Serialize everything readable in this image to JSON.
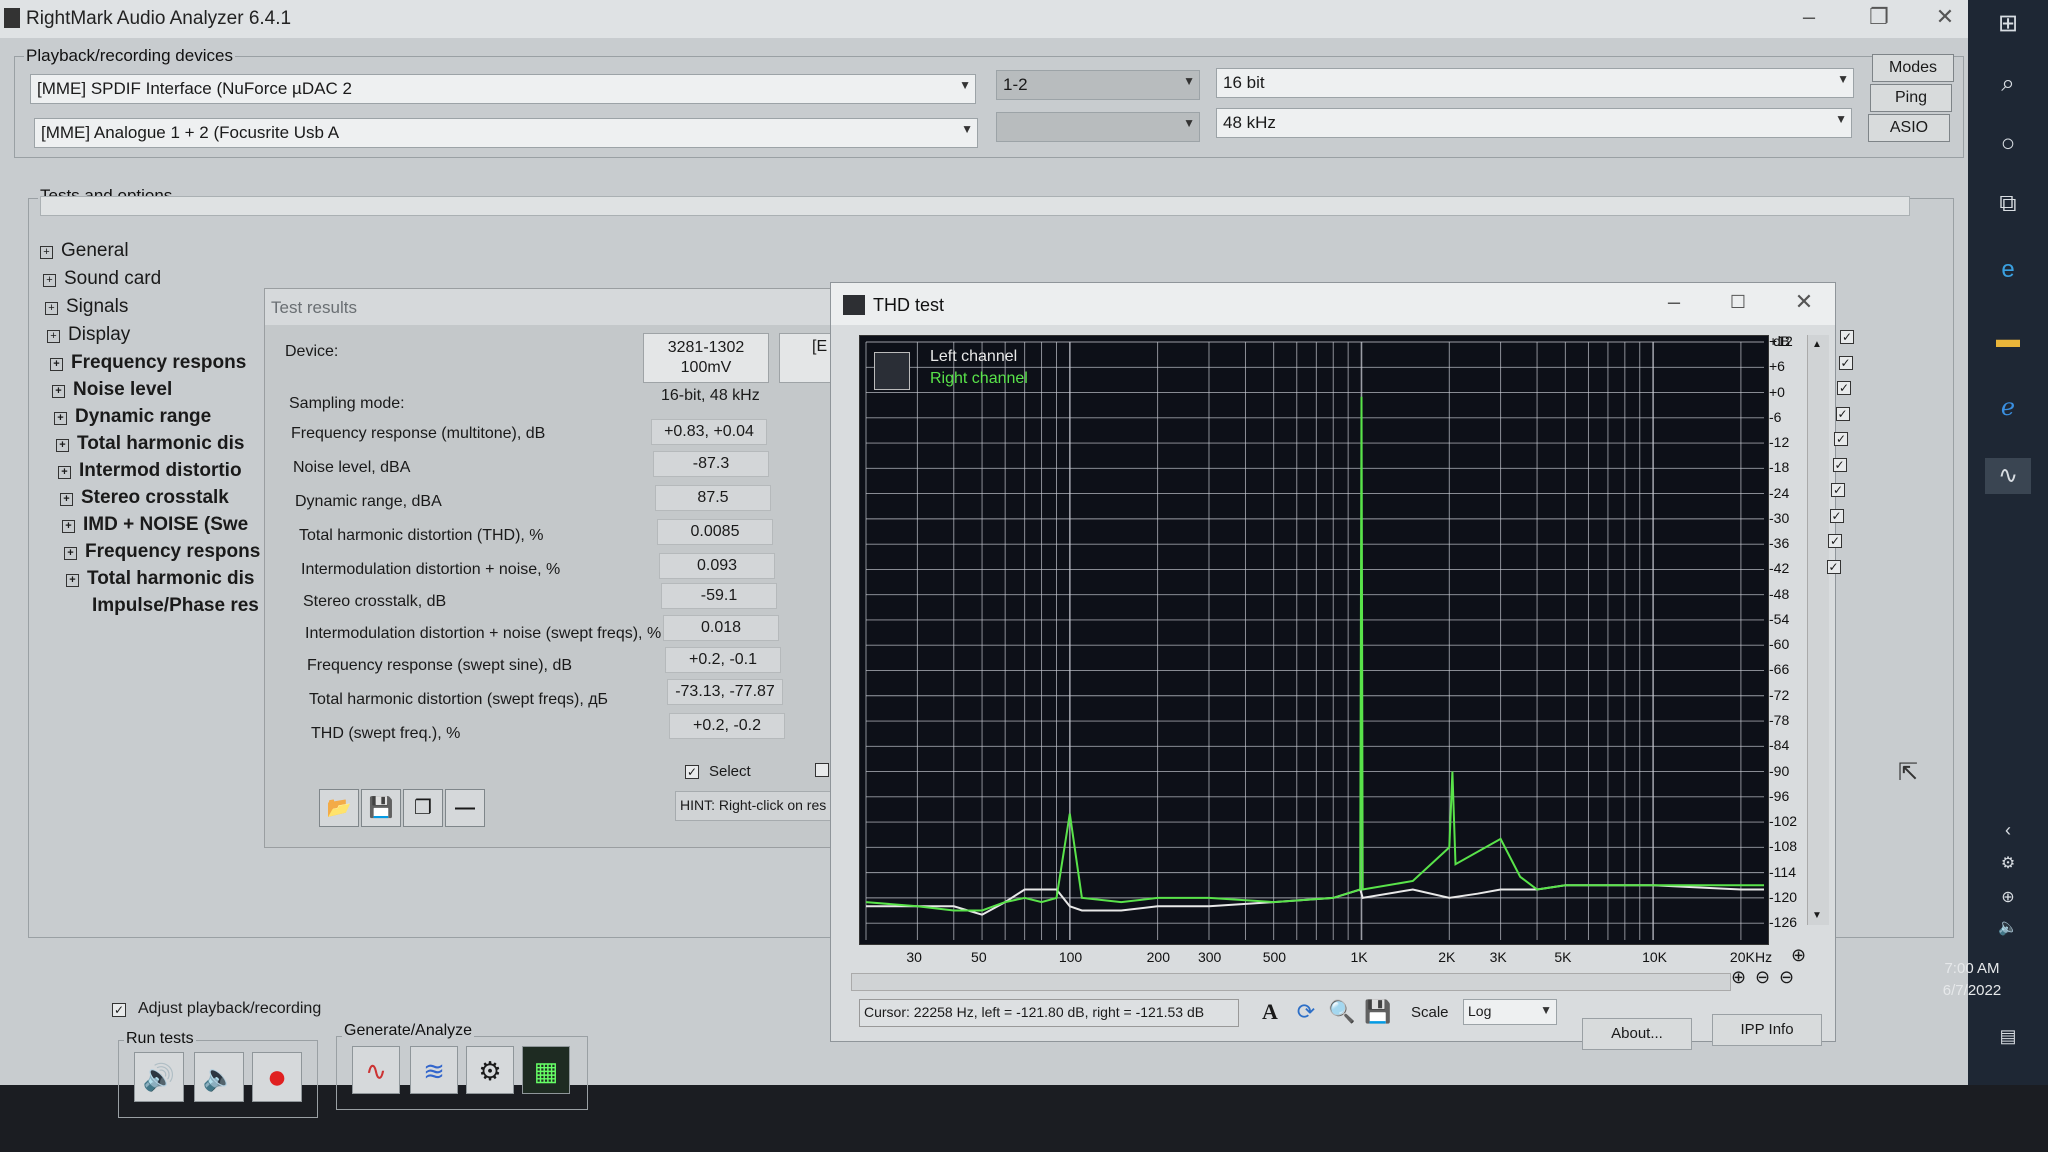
{
  "window": {
    "title": "RightMark Audio Analyzer 6.4.1"
  },
  "devices": {
    "group_label": "Playback/recording devices",
    "playback": "[MME] SPDIF Interface (NuForce µDAC 2",
    "recording": "[MME] Analogue 1 + 2 (Focusrite Usb A",
    "channels": "1-2",
    "channels2": "",
    "bits": "16 bit",
    "rate": "48 kHz",
    "buttons": [
      "Modes",
      "Ping",
      "ASIO"
    ]
  },
  "tests": {
    "group_label": "Tests and options",
    "tree": [
      "General",
      "Sound card",
      "Signals",
      "Display",
      "Frequency respons",
      "Noise level",
      "Dynamic range",
      "Total harmonic dis",
      "Intermod distortio",
      "Stereo crosstalk",
      "IMD + NOISE (Swe",
      "Frequency respons",
      "Total harmonic dis",
      "Impulse/Phase res"
    ]
  },
  "results": {
    "title": "Test results",
    "device_label": "Device:",
    "device_value": "3281-1302\n100mV",
    "device_value2": "[E",
    "sampling_label": "Sampling mode:",
    "sampling_value": "16-bit, 48 kHz",
    "rows": [
      {
        "label": "Frequency response (multitone), dB",
        "value": "+0.83, +0.04"
      },
      {
        "label": "Noise level, dBA",
        "value": "-87.3"
      },
      {
        "label": "Dynamic range, dBA",
        "value": "87.5"
      },
      {
        "label": "Total harmonic distortion (THD), %",
        "value": "0.0085"
      },
      {
        "label": "Intermodulation distortion + noise, %",
        "value": "0.093"
      },
      {
        "label": "Stereo crosstalk, dB",
        "value": "-59.1"
      },
      {
        "label": "Intermodulation distortion + noise (swept freqs), %",
        "value": "0.018"
      },
      {
        "label": "Frequency response (swept sine), dB",
        "value": "+0.2, -0.1"
      },
      {
        "label": "Total harmonic distortion (swept freqs), дБ",
        "value": "-73.13, -77.87"
      },
      {
        "label": "THD (swept freq.), %",
        "value": "+0.2, -0.2"
      }
    ],
    "select_label": "Select",
    "hint": "HINT: Right-click on res"
  },
  "thd": {
    "title": "THD test",
    "legend_left": "Left channel",
    "legend_right": "Right channel",
    "db_unit": "dB",
    "hz_unit": "Hz",
    "db_ticks": [
      "+12",
      "+6",
      "+0",
      "-6",
      "-12",
      "-18",
      "-24",
      "-30",
      "-36",
      "-42",
      "-48",
      "-54",
      "-60",
      "-66",
      "-72",
      "-78",
      "-84",
      "-90",
      "-96",
      "-102",
      "-108",
      "-114",
      "-120",
      "-126"
    ],
    "hz_ticks": [
      "30",
      "50",
      "100",
      "200",
      "300",
      "500",
      "1K",
      "2K",
      "3K",
      "5K",
      "10K",
      "20K"
    ],
    "cursor": "Cursor:  22258 Hz,  left = -121.80 dB,  right = -121.53 dB",
    "scale_label": "Scale",
    "scale_value": "Log",
    "colors": {
      "left": "#e8e8e8",
      "right": "#59e34a",
      "grid": "#c9ccd4",
      "bg": "#0d1018"
    }
  },
  "chart_data": {
    "type": "line",
    "title": "",
    "xlabel": "Hz",
    "ylabel": "dB",
    "x_scale": "log",
    "xlim": [
      20,
      24000
    ],
    "ylim": [
      -130,
      12
    ],
    "series": [
      {
        "name": "Left channel",
        "x": [
          20,
          30,
          40,
          50,
          60,
          70,
          80,
          90,
          100,
          110,
          150,
          200,
          300,
          500,
          800,
          990,
          1000,
          1010,
          1500,
          2000,
          2500,
          3000,
          4000,
          5000,
          10000,
          20000,
          24000
        ],
        "y": [
          -122,
          -122,
          -122,
          -124,
          -121,
          -118,
          -118,
          -118,
          -122,
          -123,
          -123,
          -122,
          -122,
          -121,
          -120,
          -118,
          -119,
          -120,
          -118,
          -120,
          -119,
          -118,
          -118,
          -117,
          -117,
          -118,
          -118
        ]
      },
      {
        "name": "Right channel",
        "x": [
          20,
          30,
          40,
          50,
          60,
          70,
          80,
          90,
          100,
          110,
          150,
          200,
          300,
          500,
          800,
          990,
          1000,
          1010,
          1500,
          2000,
          2050,
          2100,
          3000,
          3500,
          4000,
          5000,
          10000,
          20000,
          24000
        ],
        "y": [
          -121,
          -122,
          -123,
          -123,
          -121,
          -120,
          -121,
          -120,
          -100,
          -120,
          -121,
          -120,
          -120,
          -121,
          -120,
          -118,
          -1,
          -118,
          -116,
          -108,
          -90,
          -112,
          -106,
          -115,
          -118,
          -117,
          -117,
          -117,
          -117
        ]
      }
    ]
  },
  "bottom": {
    "adjust_label": "Adjust playback/recording",
    "run_label": "Run tests",
    "gen_label": "Generate/Analyze",
    "about": "About...",
    "ipp": "IPP Info"
  },
  "clock": {
    "time": "7:00 AM",
    "date": "6/7/2022"
  }
}
